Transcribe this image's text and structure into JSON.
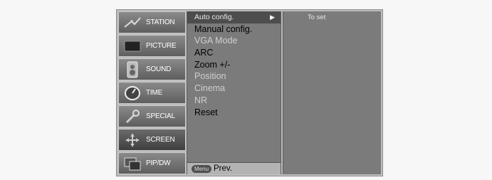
{
  "sidebar": {
    "items": [
      {
        "label": "STATION",
        "icon": "antenna-icon"
      },
      {
        "label": "PICTURE",
        "icon": "picture-icon"
      },
      {
        "label": "SOUND",
        "icon": "speaker-icon"
      },
      {
        "label": "TIME",
        "icon": "clock-icon"
      },
      {
        "label": "SPECIAL",
        "icon": "wrench-icon"
      },
      {
        "label": "SCREEN",
        "icon": "arrows-icon"
      },
      {
        "label": "PIP/DW",
        "icon": "pip-icon"
      }
    ]
  },
  "menu": {
    "items": [
      "Auto config.",
      "Manual config.",
      "VGA Mode",
      "ARC",
      "Zoom +/-",
      "Position",
      "Cinema",
      "NR",
      "Reset"
    ],
    "footer_key": "Menu",
    "footer_label": "Prev."
  },
  "submenu": {
    "items": [
      "To set"
    ]
  },
  "colors": {
    "osd_bg": "#bdbdbd",
    "menu_bg": "#7b7b7b",
    "selected_bg": "#4d4d4d"
  }
}
